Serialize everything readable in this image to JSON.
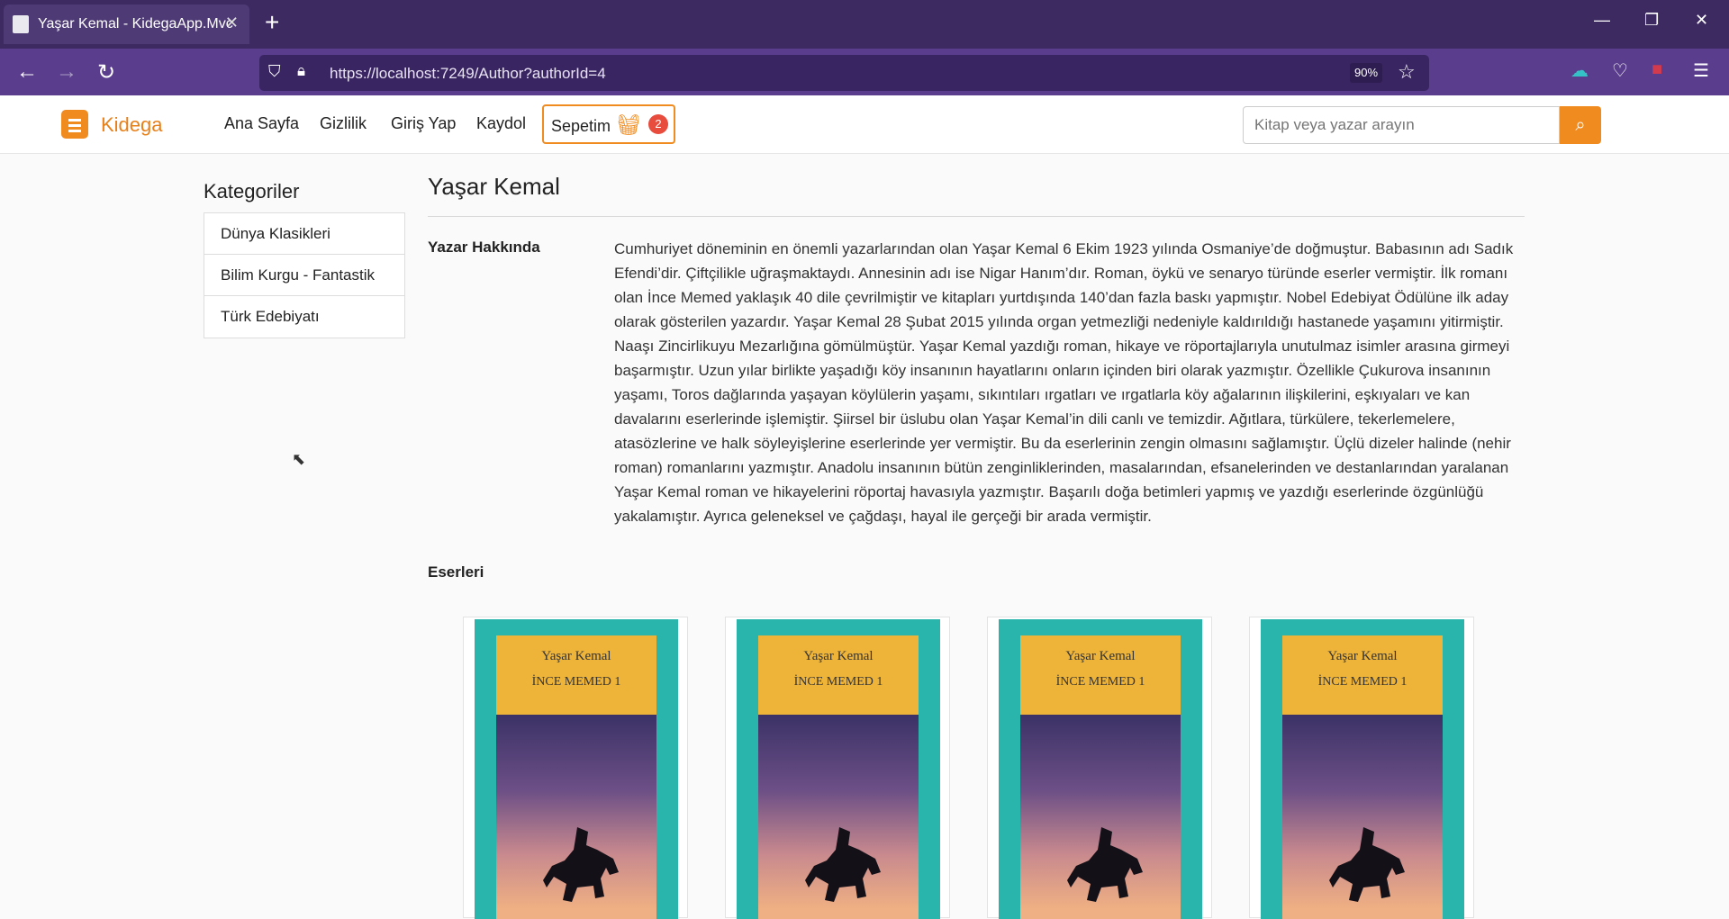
{
  "browser": {
    "tab_title": "Yaşar Kemal - KidegaApp.Mvc",
    "url": "https://localhost:7249/Author?authorId=4",
    "zoom": "90%"
  },
  "site": {
    "brand": "Kidega",
    "nav": [
      "Ana Sayfa",
      "Gizlilik",
      "Giriş Yap",
      "Kaydol"
    ],
    "cart_label": "Sepetim",
    "cart_count": "2",
    "search_placeholder": "Kitap veya yazar arayın",
    "accent": "#f08b1f"
  },
  "sidebar": {
    "title": "Kategoriler",
    "items": [
      "Dünya Klasikleri",
      "Bilim Kurgu - Fantastik",
      "Türk Edebiyatı"
    ]
  },
  "author": {
    "name": "Yaşar Kemal",
    "about_label": "Yazar Hakkında",
    "bio": "Cumhuriyet döneminin en önemli yazarlarından olan Yaşar Kemal 6 Ekim 1923 yılında Osmaniye’de doğmuştur. Babasının adı Sadık Efendi’dir. Çiftçilikle uğraşmaktaydı. Annesinin adı ise Nigar Hanım’dır. Roman, öykü ve senaryo türünde eserler vermiştir.  İlk romanı olan İnce Memed yaklaşık 40 dile çevrilmiştir ve kitapları yurtdışında 140’dan fazla baskı yapmıştır. Nobel Edebiyat Ödülüne ilk aday olarak gösterilen yazardır. Yaşar Kemal 28 Şubat 2015 yılında organ yetmezliği nedeniyle kaldırıldığı hastanede yaşamını yitirmiştir. Naaşı Zincirlikuyu Mezarlığına gömülmüştür.  Yaşar Kemal yazdığı roman, hikaye ve röportajlarıyla unutulmaz isimler arasına girmeyi başarmıştır. Uzun yılar birlikte yaşadığı köy insanının hayatlarını onların içinden biri olarak yazmıştır.   Özellikle Çukurova insanının yaşamı, Toros dağlarında yaşayan köylülerin yaşamı, sıkıntıları ırgatları ve ırgatlarla köy ağalarının ilişkilerini, eşkıyaları ve kan davalarını eserlerinde işlemiştir.  Şiirsel bir üslubu olan Yaşar Kemal’in dili canlı ve temizdir. Ağıtlara, türkülere, tekerlemelere, atasözlerine ve halk söyleyişlerine eserlerinde yer vermiştir. Bu da eserlerinin zengin olmasını sağlamıştır.  Üçlü dizeler halinde (nehir roman) romanlarını yazmıştır. Anadolu insanının bütün zenginliklerinden, masalarından, efsanelerinden ve destanlarından yaralanan Yaşar Kemal roman ve hikayelerini röportaj havasıyla yazmıştır.  Başarılı doğa betimleri yapmış ve yazdığı eserlerinde özgünlüğü yakalamıştır. Ayrıca geleneksel ve çağdaşı, hayal ile gerçeği bir arada vermiştir.",
    "works_label": "Eserleri"
  },
  "books": [
    {
      "author": "Yaşar Kemal",
      "title": "İNCE MEMED 1"
    },
    {
      "author": "Yaşar Kemal",
      "title": "İNCE MEMED 1"
    },
    {
      "author": "Yaşar Kemal",
      "title": "İNCE MEMED 1"
    },
    {
      "author": "Yaşar Kemal",
      "title": "İNCE MEMED 1"
    }
  ]
}
